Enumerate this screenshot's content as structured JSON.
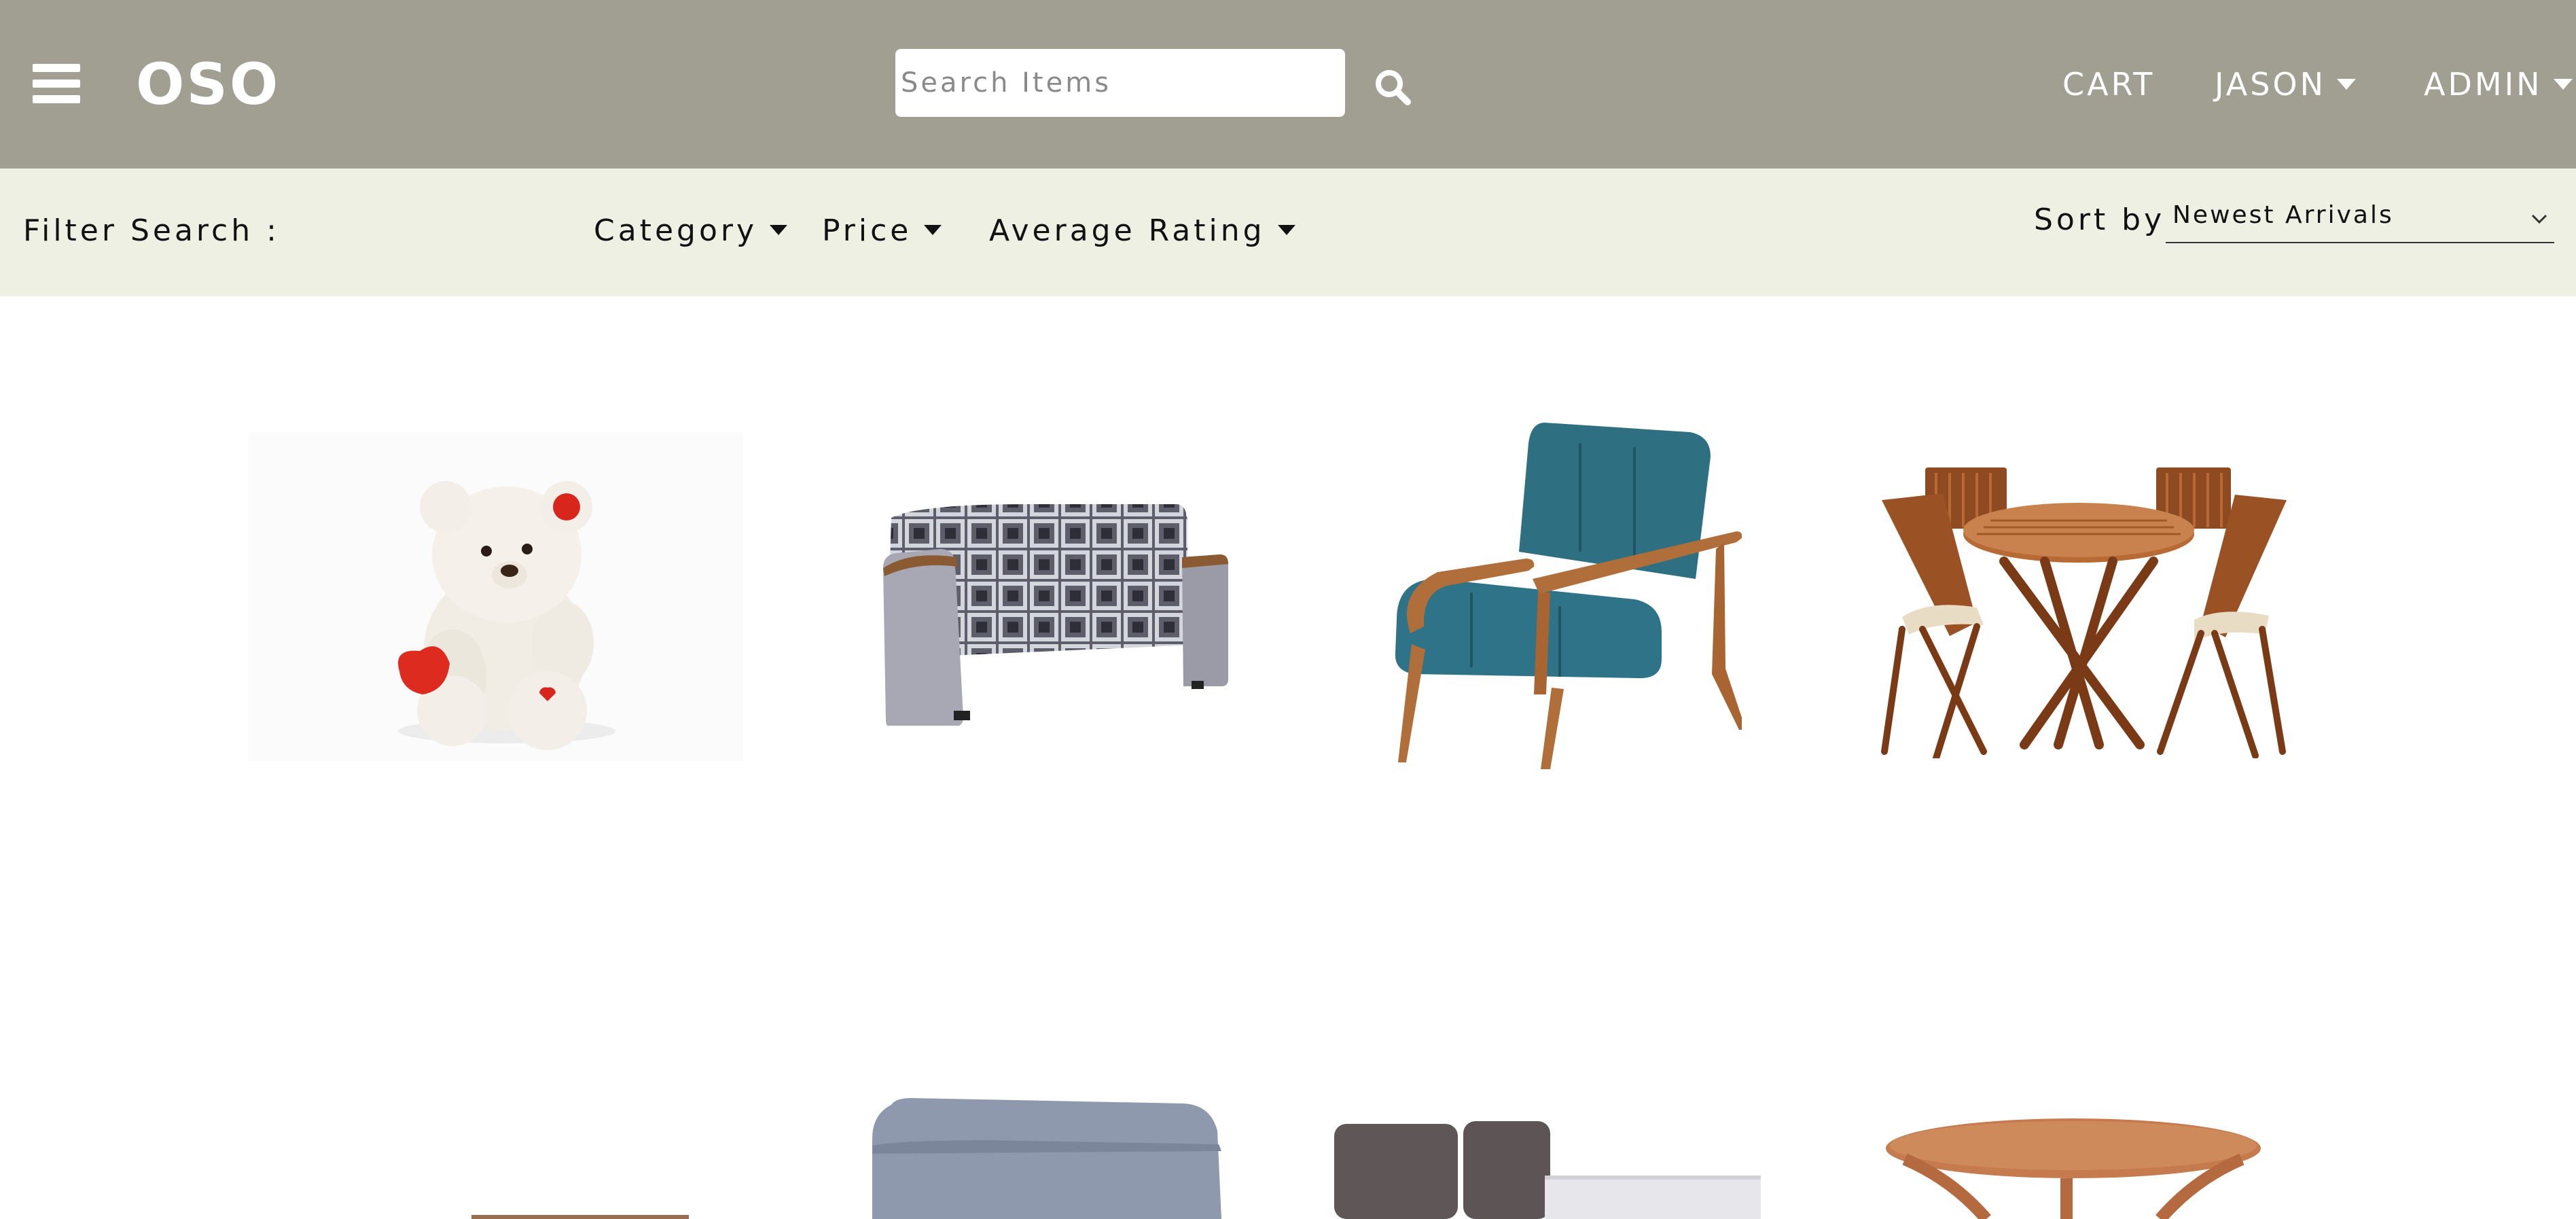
{
  "header": {
    "menu_icon": "hamburger-menu-icon",
    "brand": "OSO",
    "search": {
      "placeholder": "Search Items",
      "value": "",
      "icon": "search-icon"
    },
    "nav": [
      {
        "label": "CART",
        "dropdown": false
      },
      {
        "label": "JASON",
        "dropdown": true
      },
      {
        "label": "ADMIN",
        "dropdown": true
      }
    ]
  },
  "filters": {
    "label": "Filter Search :",
    "dropdowns": [
      "Category",
      "Price",
      "Average Rating"
    ],
    "sort_label": "Sort by",
    "sort_value": "Newest Arrivals"
  },
  "colors": {
    "header_bg": "#a19e92",
    "filter_bg": "#eff0e4",
    "text": "#111111"
  },
  "products": [
    {
      "image": "teddy-bear"
    },
    {
      "image": "patterned-sofa"
    },
    {
      "image": "teal-armchair"
    },
    {
      "image": "patio-dining-set"
    },
    {
      "image": "wooden-item"
    },
    {
      "image": "grey-ottoman"
    },
    {
      "image": "upholstered-bed"
    },
    {
      "image": "round-coffee-table"
    }
  ]
}
